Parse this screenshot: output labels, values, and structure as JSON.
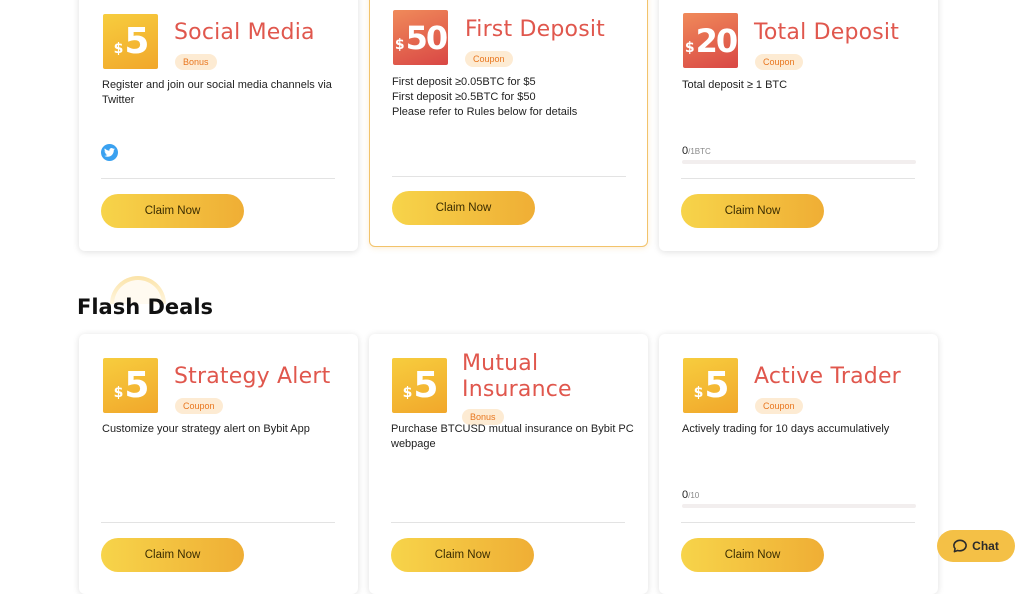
{
  "top_cards": [
    {
      "currency": "$",
      "amount": "5",
      "title": "Social Media",
      "tag": "Bonus",
      "description": "Register and join our social media channels via Twitter",
      "button": "Claim Now",
      "social_icon": "twitter-icon"
    },
    {
      "currency": "$",
      "amount": "50",
      "title": "First Deposit",
      "tag": "Coupon",
      "description": "First deposit ≥0.05BTC for $5\nFirst deposit ≥0.5BTC for $50\nPlease refer to Rules below for details",
      "button": "Claim Now"
    },
    {
      "currency": "$",
      "amount": "20",
      "title": "Total Deposit",
      "tag": "Coupon",
      "description": "Total deposit ≥ 1 BTC",
      "progress_value": "0",
      "progress_unit": "/1BTC",
      "progress_fraction": 0,
      "button": "Claim Now"
    }
  ],
  "section": {
    "title": "Flash Deals"
  },
  "flash_cards": [
    {
      "currency": "$",
      "amount": "5",
      "title": "Strategy Alert",
      "tag": "Coupon",
      "description": "Customize your strategy alert on Bybit App",
      "button": "Claim Now"
    },
    {
      "currency": "$",
      "amount": "5",
      "title": "Mutual Insurance",
      "tag": "Bonus",
      "description": "Purchase BTCUSD mutual insurance on Bybit PC webpage",
      "button": "Claim Now"
    },
    {
      "currency": "$",
      "amount": "5",
      "title": "Active Trader",
      "tag": "Coupon",
      "description": "Actively trading for 10 days accumulatively",
      "progress_value": "0",
      "progress_unit": "/10",
      "progress_fraction": 0,
      "button": "Claim Now"
    }
  ],
  "chat": {
    "label": "Chat",
    "icon": "chat-bubble-icon"
  },
  "colors": {
    "accent": "#f1b13a",
    "title": "#e0574d",
    "tag_bg": "#fdebd3"
  }
}
